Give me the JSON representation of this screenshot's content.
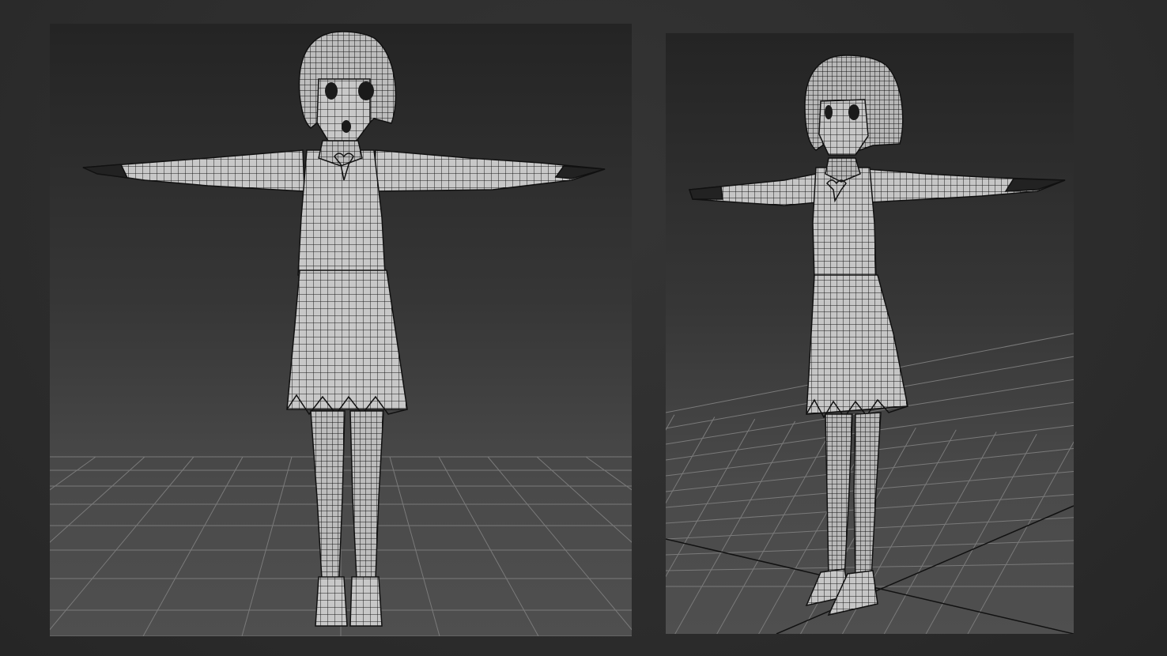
{
  "viewports": [
    {
      "id": "front",
      "view": "front",
      "shading": "wireframe-over-shaded",
      "grid": true
    },
    {
      "id": "perspective",
      "view": "perspective",
      "shading": "wireframe-over-shaded",
      "grid": true
    }
  ],
  "colors": {
    "background": "#2c2c2c",
    "grid_line": "#7a7a7a",
    "mesh_fill": "#c9c9c9",
    "wire": "#1a1a1a"
  },
  "icons": {
    "character_model": "character-mesh-icon"
  }
}
